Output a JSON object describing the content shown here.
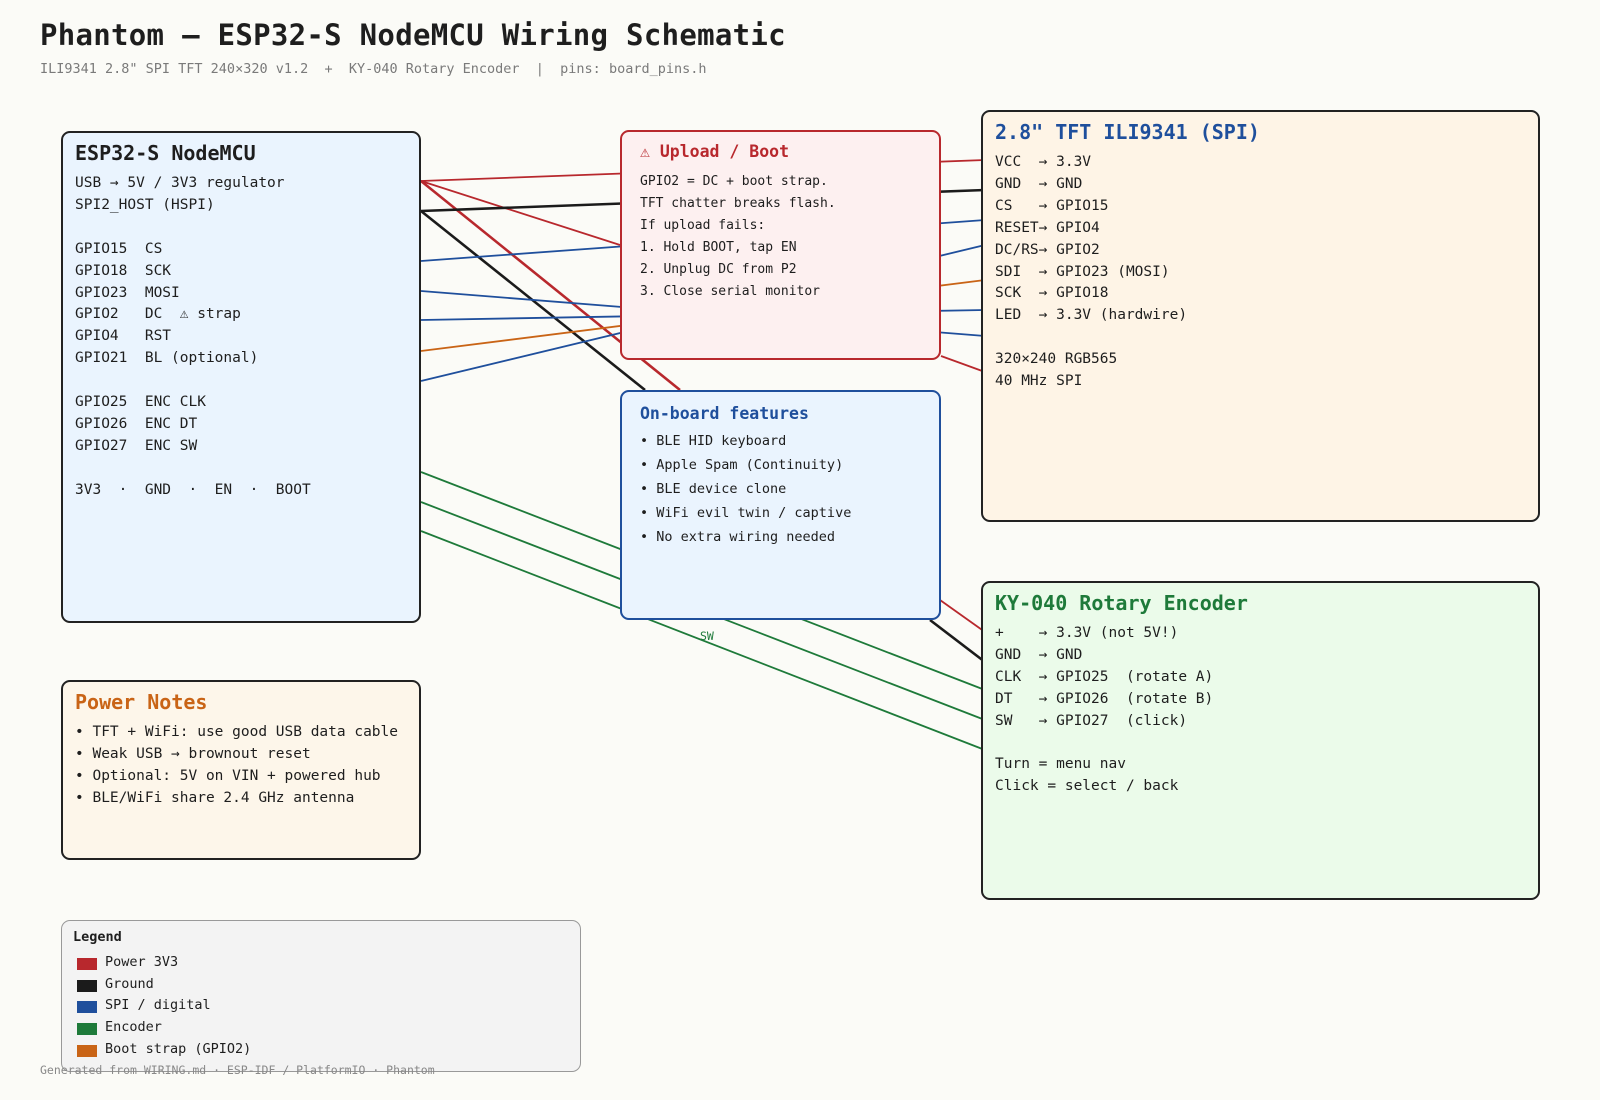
{
  "title": "Phantom — ESP32-S NodeMCU Wiring Schematic",
  "subtitle": "ILI9341 2.8\" SPI TFT 240×320 v1.2  +  KY-040 Rotary Encoder  |  pins: board_pins.h",
  "colors": {
    "power": "#b8282d",
    "ground": "#1b1b1b",
    "spi": "#1f4f9c",
    "encoder": "#1e7a3a",
    "boot_strap": "#c96416"
  },
  "esp": {
    "title": "ESP32-S NodeMCU",
    "lines": [
      "USB → 5V / 3V3 regulator",
      "SPI2_HOST (HSPI)",
      "",
      "GPIO15  CS",
      "GPIO18  SCK",
      "GPIO23  MOSI",
      "GPIO2   DC  ⚠ strap",
      "GPIO4   RST",
      "GPIO21  BL (optional)",
      "",
      "GPIO25  ENC CLK",
      "GPIO26  ENC DT",
      "GPIO27  ENC SW",
      "",
      "3V3  ·  GND  ·  EN  ·  BOOT"
    ]
  },
  "boot": {
    "title": "⚠ Upload / Boot",
    "lines": [
      "GPIO2 = DC + boot strap.",
      "TFT chatter breaks flash.",
      "",
      "If upload fails:",
      "1. Hold BOOT, tap EN",
      "2. Unplug DC from P2",
      "3. Close serial monitor"
    ]
  },
  "features": {
    "title": "On-board features",
    "items": [
      "• BLE HID keyboard",
      "• Apple Spam (Continuity)",
      "• BLE device clone",
      "• WiFi evil twin / captive",
      "• No extra wiring needed"
    ]
  },
  "tft": {
    "title": "2.8\" TFT ILI9341 (SPI)",
    "lines": [
      "VCC  → 3.3V",
      "GND  → GND",
      "CS   → GPIO15",
      "RESET→ GPIO4",
      "DC/RS→ GPIO2",
      "SDI  → GPIO23 (MOSI)",
      "SCK  → GPIO18",
      "LED  → 3.3V (hardwire)",
      "",
      "320×240 RGB565",
      "40 MHz SPI"
    ]
  },
  "encoder": {
    "title": "KY-040 Rotary Encoder",
    "lines": [
      "+    → 3.3V (not 5V!)",
      "GND  → GND",
      "CLK  → GPIO25  (rotate A)",
      "DT   → GPIO26  (rotate B)",
      "SW   → GPIO27  (click)",
      "",
      "Turn = menu nav",
      "Click = select / back"
    ]
  },
  "power": {
    "title": "Power Notes",
    "items": [
      "• TFT + WiFi: use good USB data cable",
      "• Weak USB → brownout reset",
      "• Optional: 5V on VIN + powered hub",
      "• BLE/WiFi share 2.4 GHz antenna"
    ]
  },
  "legend": {
    "title": "Legend",
    "items": [
      {
        "label": "Power 3V3",
        "color": "#b8282d"
      },
      {
        "label": "Ground",
        "color": "#1b1b1b"
      },
      {
        "label": "SPI / digital",
        "color": "#1f4f9c"
      },
      {
        "label": "Encoder",
        "color": "#1e7a3a"
      },
      {
        "label": "Boot strap (GPIO2)",
        "color": "#c96416"
      }
    ]
  },
  "wire_label_sw": "SW",
  "footer": "Generated from WIRING.md · ESP-IDF / PlatformIO · Phantom"
}
